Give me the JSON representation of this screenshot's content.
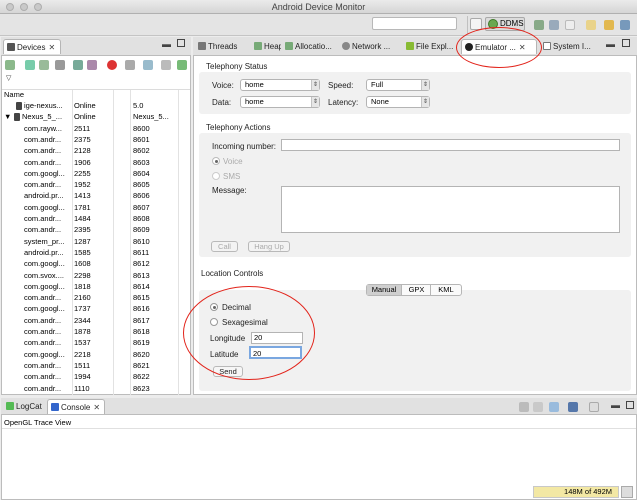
{
  "window": {
    "title": "Android Device Monitor"
  },
  "perspective": {
    "ddms_label": "DDMS"
  },
  "devices_panel": {
    "tab_label": "Devices",
    "headers": [
      "Name",
      "",
      "",
      ""
    ],
    "rows": [
      {
        "name": "ige-nexus...",
        "col2": "Online",
        "col3": "5.0"
      },
      {
        "name": "Nexus_5_...",
        "col2": "Online",
        "col3": "Nexus_5..."
      },
      {
        "name": "com.rayw...",
        "col2": "2511",
        "col3": "8600"
      },
      {
        "name": "com.andr...",
        "col2": "2375",
        "col3": "8601"
      },
      {
        "name": "com.andr...",
        "col2": "2128",
        "col3": "8602"
      },
      {
        "name": "com.andr...",
        "col2": "1906",
        "col3": "8603"
      },
      {
        "name": "com.googl...",
        "col2": "2255",
        "col3": "8604"
      },
      {
        "name": "com.andr...",
        "col2": "1952",
        "col3": "8605"
      },
      {
        "name": "android.pr...",
        "col2": "1413",
        "col3": "8606"
      },
      {
        "name": "com.googl...",
        "col2": "1781",
        "col3": "8607"
      },
      {
        "name": "com.andr...",
        "col2": "1484",
        "col3": "8608"
      },
      {
        "name": "com.andr...",
        "col2": "2395",
        "col3": "8609"
      },
      {
        "name": "system_pr...",
        "col2": "1287",
        "col3": "8610"
      },
      {
        "name": "android.pr...",
        "col2": "1585",
        "col3": "8611"
      },
      {
        "name": "com.googl...",
        "col2": "1608",
        "col3": "8612"
      },
      {
        "name": "com.svox....",
        "col2": "2298",
        "col3": "8613"
      },
      {
        "name": "com.googl...",
        "col2": "1818",
        "col3": "8614"
      },
      {
        "name": "com.andr...",
        "col2": "2160",
        "col3": "8615"
      },
      {
        "name": "com.googl...",
        "col2": "1737",
        "col3": "8616"
      },
      {
        "name": "com.andr...",
        "col2": "2344",
        "col3": "8617"
      },
      {
        "name": "com.andr...",
        "col2": "1878",
        "col3": "8618"
      },
      {
        "name": "com.andr...",
        "col2": "1537",
        "col3": "8619"
      },
      {
        "name": "com.googl...",
        "col2": "2218",
        "col3": "8620"
      },
      {
        "name": "com.andr...",
        "col2": "1511",
        "col3": "8621"
      },
      {
        "name": "com.andr...",
        "col2": "1994",
        "col3": "8622"
      },
      {
        "name": "com.andr...",
        "col2": "1110",
        "col3": "8623"
      }
    ]
  },
  "right_tabs": [
    "Threads",
    "Heap",
    "Allocatio...",
    "Network ...",
    "File Expl...",
    "Emulator ...",
    "System I..."
  ],
  "telephony_status": {
    "title": "Telephony Status",
    "voice_label": "Voice:",
    "voice_value": "home",
    "speed_label": "Speed:",
    "speed_value": "Full",
    "data_label": "Data:",
    "data_value": "home",
    "latency_label": "Latency:",
    "latency_value": "None"
  },
  "telephony_actions": {
    "title": "Telephony Actions",
    "incoming_label": "Incoming number:",
    "voice_radio": "Voice",
    "sms_radio": "SMS",
    "message_label": "Message:",
    "call_button": "Call",
    "hangup_button": "Hang Up"
  },
  "location_controls": {
    "title": "Location Controls",
    "tabs": [
      "Manual",
      "GPX",
      "KML"
    ],
    "decimal_radio": "Decimal",
    "sexagesimal_radio": "Sexagesimal",
    "longitude_label": "Longitude",
    "longitude_value": "20",
    "latitude_label": "Latitude",
    "latitude_value": "20",
    "send_button": "Send"
  },
  "bottom_panel": {
    "tabs": [
      "LogCat",
      "Console"
    ],
    "console_title": "OpenGL Trace View"
  },
  "status": {
    "memory": "148M of 492M"
  },
  "colors": {
    "annotation": "#e2231a",
    "tab_active": "#ffffff"
  }
}
